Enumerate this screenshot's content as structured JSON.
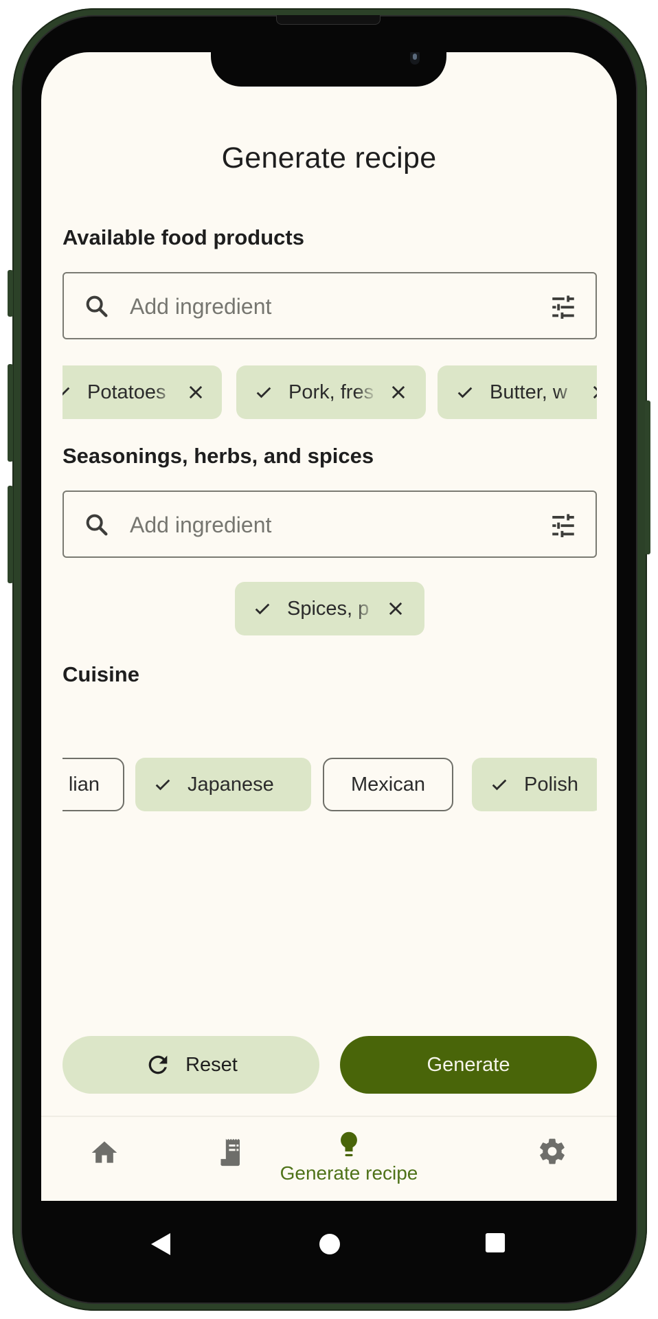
{
  "page": {
    "title": "Generate recipe"
  },
  "sections": {
    "food_products": {
      "title": "Available food products",
      "search_placeholder": "Add ingredient",
      "chips": [
        {
          "label": "Potatoes",
          "selected": true
        },
        {
          "label": "Pork, fres",
          "selected": true
        },
        {
          "label": "Butter, w",
          "selected": true
        }
      ]
    },
    "seasonings": {
      "title": "Seasonings, herbs, and spices",
      "search_placeholder": "Add ingredient",
      "chips": [
        {
          "label": "Spices, p",
          "selected": true
        }
      ]
    },
    "cuisine": {
      "title": "Cuisine",
      "chips": [
        {
          "label": "lian",
          "selected": false
        },
        {
          "label": "Japanese",
          "selected": true
        },
        {
          "label": "Mexican",
          "selected": false
        },
        {
          "label": "Polish",
          "selected": true
        }
      ]
    }
  },
  "actions": {
    "reset_label": "Reset",
    "generate_label": "Generate"
  },
  "bottom_nav": {
    "items": [
      {
        "name": "home",
        "icon": "home-icon",
        "label": ""
      },
      {
        "name": "recipes",
        "icon": "receipt-icon",
        "label": ""
      },
      {
        "name": "generate-recipe",
        "icon": "lightbulb-icon",
        "label": "Generate recipe",
        "active": true
      },
      {
        "name": "settings",
        "icon": "gear-icon",
        "label": ""
      }
    ]
  },
  "colors": {
    "accent": "#496509",
    "chip_selected": "#dce6c8",
    "background": "#fdfaf3",
    "nav_active": "#4e7218",
    "nav_inactive": "#6e6e6a"
  }
}
